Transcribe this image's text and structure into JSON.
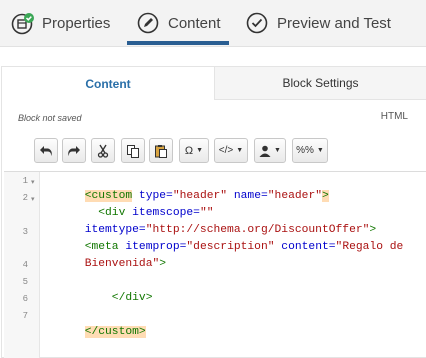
{
  "steps": [
    {
      "label": "Properties",
      "icon": "properties-check-icon"
    },
    {
      "label": "Content",
      "icon": "pencil-icon"
    },
    {
      "label": "Preview and Test",
      "icon": "check-circle-icon"
    }
  ],
  "active_step": "Content",
  "subtabs": {
    "content": "Content",
    "settings": "Block Settings"
  },
  "status": "Block not saved",
  "mode_label": "HTML",
  "toolbar": {
    "undo": "undo-icon",
    "redo": "redo-icon",
    "cut": "cut-icon",
    "copy": "copy-icon",
    "paste": "paste-icon",
    "special_chars": "Ω",
    "source": "</>",
    "personalize": "person-icon",
    "variables": "%%"
  },
  "line_numbers": [
    "1",
    "2",
    "3",
    "4",
    "5",
    "6",
    "7"
  ],
  "code": {
    "l1_open": "<custom",
    "l1_a1": " type=",
    "l1_v1": "\"header\"",
    "l1_a2": " name=",
    "l1_v2": "\"header\"",
    "l1_close": ">",
    "l2_open": "  <div",
    "l2_a1": " itemscope=",
    "l2_v1": "\"\"",
    "l2b_a2": "itemtype=",
    "l2b_v2": "\"http://schema.org/DiscountOffer\"",
    "l2b_close": ">",
    "l3_open": "<meta",
    "l3_a1": " itemprop=",
    "l3_v1": "\"description\"",
    "l3_a2": " content=",
    "l3_v2": "\"Regalo de",
    "l3b_v2": "Bienvenida\"",
    "l3b_close": ">",
    "l5": "    </div>",
    "l7": "</custom>"
  },
  "colors": {
    "accent": "#2a5e92",
    "tab_active_text": "#2a6fa8",
    "highlight": "#ffdcb4",
    "check_green": "#3aa655"
  }
}
